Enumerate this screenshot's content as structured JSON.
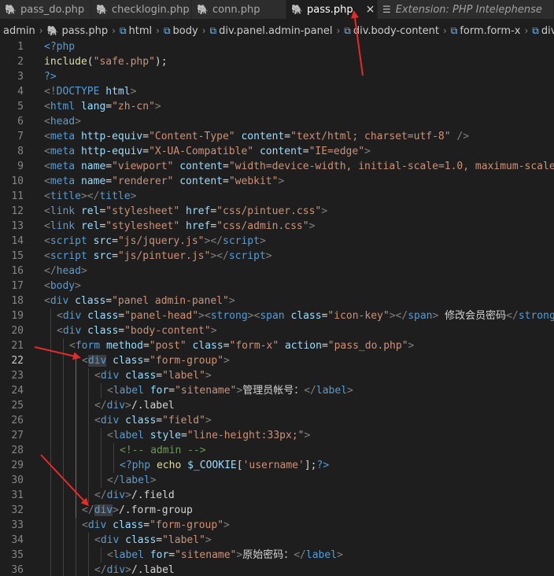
{
  "tabs": [
    {
      "label": "pass_do.php",
      "icon": "php-icon",
      "active": false
    },
    {
      "label": "checklogin.php",
      "icon": "php-icon",
      "active": false
    },
    {
      "label": "conn.php",
      "icon": "php-icon",
      "active": false
    },
    {
      "label": "pass.php",
      "icon": "php-icon",
      "active": true,
      "close": "×"
    },
    {
      "label": "Extension: PHP Intelephense",
      "icon": "extension-icon",
      "active": false
    }
  ],
  "breadcrumb": [
    "admin",
    "pass.php",
    "html",
    "body",
    "div.panel.admin-panel",
    "div.body-content",
    "form.form-x",
    "div."
  ],
  "lines": [
    {
      "n": "1",
      "indent": 0,
      "tokens": [
        [
          "t-php",
          "<?php"
        ]
      ]
    },
    {
      "n": "2",
      "indent": 0,
      "tokens": [
        [
          "t-fn",
          "include"
        ],
        [
          "t-plain",
          "("
        ],
        [
          "t-str",
          "\"safe.php\""
        ],
        [
          "t-plain",
          ");"
        ]
      ]
    },
    {
      "n": "3",
      "indent": 0,
      "tokens": [
        [
          "t-php",
          "?>"
        ]
      ]
    },
    {
      "n": "4",
      "indent": 0,
      "tokens": [
        [
          "t-punc",
          "<!"
        ],
        [
          "t-tag",
          "DOCTYPE"
        ],
        [
          "t-attr",
          " html"
        ],
        [
          "t-punc",
          ">"
        ]
      ]
    },
    {
      "n": "5",
      "indent": 0,
      "tokens": [
        [
          "t-punc",
          "<"
        ],
        [
          "t-tag",
          "html"
        ],
        [
          "t-attr",
          " lang"
        ],
        [
          "t-plain",
          "="
        ],
        [
          "t-str",
          "\"zh-cn\""
        ],
        [
          "t-punc",
          ">"
        ]
      ]
    },
    {
      "n": "6",
      "indent": 0,
      "tokens": [
        [
          "t-punc",
          "<"
        ],
        [
          "t-tag",
          "head"
        ],
        [
          "t-punc",
          ">"
        ]
      ]
    },
    {
      "n": "7",
      "indent": 0,
      "tokens": [
        [
          "t-punc",
          "<"
        ],
        [
          "t-tag",
          "meta"
        ],
        [
          "t-attr",
          " http-equiv"
        ],
        [
          "t-plain",
          "="
        ],
        [
          "t-str",
          "\"Content-Type\""
        ],
        [
          "t-attr",
          " content"
        ],
        [
          "t-plain",
          "="
        ],
        [
          "t-str",
          "\"text/html; charset=utf-8\""
        ],
        [
          "t-punc",
          " />"
        ]
      ]
    },
    {
      "n": "8",
      "indent": 0,
      "tokens": [
        [
          "t-punc",
          "<"
        ],
        [
          "t-tag",
          "meta"
        ],
        [
          "t-attr",
          " http-equiv"
        ],
        [
          "t-plain",
          "="
        ],
        [
          "t-str",
          "\"X-UA-Compatible\""
        ],
        [
          "t-attr",
          " content"
        ],
        [
          "t-plain",
          "="
        ],
        [
          "t-str",
          "\"IE=edge\""
        ],
        [
          "t-punc",
          ">"
        ]
      ]
    },
    {
      "n": "9",
      "indent": 0,
      "tokens": [
        [
          "t-punc",
          "<"
        ],
        [
          "t-tag",
          "meta"
        ],
        [
          "t-attr",
          " name"
        ],
        [
          "t-plain",
          "="
        ],
        [
          "t-str",
          "\"viewport\""
        ],
        [
          "t-attr",
          " content"
        ],
        [
          "t-plain",
          "="
        ],
        [
          "t-str",
          "\"width=device-width, initial-scale=1.0, maximum-scale="
        ]
      ]
    },
    {
      "n": "10",
      "indent": 0,
      "tokens": [
        [
          "t-punc",
          "<"
        ],
        [
          "t-tag",
          "meta"
        ],
        [
          "t-attr",
          " name"
        ],
        [
          "t-plain",
          "="
        ],
        [
          "t-str",
          "\"renderer\""
        ],
        [
          "t-attr",
          " content"
        ],
        [
          "t-plain",
          "="
        ],
        [
          "t-str",
          "\"webkit\""
        ],
        [
          "t-punc",
          ">"
        ]
      ]
    },
    {
      "n": "11",
      "indent": 0,
      "tokens": [
        [
          "t-punc",
          "<"
        ],
        [
          "t-tag",
          "title"
        ],
        [
          "t-punc",
          "></"
        ],
        [
          "t-tag",
          "title"
        ],
        [
          "t-punc",
          ">"
        ]
      ]
    },
    {
      "n": "12",
      "indent": 0,
      "tokens": [
        [
          "t-punc",
          "<"
        ],
        [
          "t-tag",
          "link"
        ],
        [
          "t-attr",
          " rel"
        ],
        [
          "t-plain",
          "="
        ],
        [
          "t-str",
          "\"stylesheet\""
        ],
        [
          "t-attr",
          " href"
        ],
        [
          "t-plain",
          "="
        ],
        [
          "t-str",
          "\"css/pintuer.css\""
        ],
        [
          "t-punc",
          ">"
        ]
      ]
    },
    {
      "n": "13",
      "indent": 0,
      "tokens": [
        [
          "t-punc",
          "<"
        ],
        [
          "t-tag",
          "link"
        ],
        [
          "t-attr",
          " rel"
        ],
        [
          "t-plain",
          "="
        ],
        [
          "t-str",
          "\"stylesheet\""
        ],
        [
          "t-attr",
          " href"
        ],
        [
          "t-plain",
          "="
        ],
        [
          "t-str",
          "\"css/admin.css\""
        ],
        [
          "t-punc",
          ">"
        ]
      ]
    },
    {
      "n": "14",
      "indent": 0,
      "tokens": [
        [
          "t-punc",
          "<"
        ],
        [
          "t-tag",
          "script"
        ],
        [
          "t-attr",
          " src"
        ],
        [
          "t-plain",
          "="
        ],
        [
          "t-str",
          "\"js/jquery.js\""
        ],
        [
          "t-punc",
          "></"
        ],
        [
          "t-tag",
          "script"
        ],
        [
          "t-punc",
          ">"
        ]
      ]
    },
    {
      "n": "15",
      "indent": 0,
      "tokens": [
        [
          "t-punc",
          "<"
        ],
        [
          "t-tag",
          "script"
        ],
        [
          "t-attr",
          " src"
        ],
        [
          "t-plain",
          "="
        ],
        [
          "t-str",
          "\"js/pintuer.js\""
        ],
        [
          "t-punc",
          "></"
        ],
        [
          "t-tag",
          "script"
        ],
        [
          "t-punc",
          ">"
        ]
      ]
    },
    {
      "n": "16",
      "indent": 0,
      "tokens": [
        [
          "t-punc",
          "</"
        ],
        [
          "t-tag",
          "head"
        ],
        [
          "t-punc",
          ">"
        ]
      ]
    },
    {
      "n": "17",
      "indent": 0,
      "tokens": [
        [
          "t-punc",
          "<"
        ],
        [
          "t-tag",
          "body"
        ],
        [
          "t-punc",
          ">"
        ]
      ]
    },
    {
      "n": "18",
      "indent": 0,
      "tokens": [
        [
          "t-punc",
          "<"
        ],
        [
          "t-tag",
          "div"
        ],
        [
          "t-attr",
          " class"
        ],
        [
          "t-plain",
          "="
        ],
        [
          "t-str",
          "\"panel admin-panel\""
        ],
        [
          "t-punc",
          ">"
        ]
      ]
    },
    {
      "n": "19",
      "indent": 1,
      "tokens": [
        [
          "t-punc",
          "<"
        ],
        [
          "t-tag",
          "div"
        ],
        [
          "t-attr",
          " class"
        ],
        [
          "t-plain",
          "="
        ],
        [
          "t-str",
          "\"panel-head\""
        ],
        [
          "t-punc",
          "><"
        ],
        [
          "t-tag",
          "strong"
        ],
        [
          "t-punc",
          "><"
        ],
        [
          "t-tag",
          "span"
        ],
        [
          "t-attr",
          " class"
        ],
        [
          "t-plain",
          "="
        ],
        [
          "t-str",
          "\"icon-key\""
        ],
        [
          "t-punc",
          "></"
        ],
        [
          "t-tag",
          "span"
        ],
        [
          "t-punc",
          ">"
        ],
        [
          "t-txt",
          " 修改会员密码"
        ],
        [
          "t-punc",
          "</"
        ],
        [
          "t-tag",
          "strong"
        ]
      ]
    },
    {
      "n": "20",
      "indent": 1,
      "tokens": [
        [
          "t-punc",
          "<"
        ],
        [
          "t-tag",
          "div"
        ],
        [
          "t-attr",
          " class"
        ],
        [
          "t-plain",
          "="
        ],
        [
          "t-str",
          "\"body-content\""
        ],
        [
          "t-punc",
          ">"
        ]
      ]
    },
    {
      "n": "21",
      "indent": 2,
      "tokens": [
        [
          "t-punc",
          "<"
        ],
        [
          "t-tag",
          "form"
        ],
        [
          "t-attr",
          " method"
        ],
        [
          "t-plain",
          "="
        ],
        [
          "t-str",
          "\"post\""
        ],
        [
          "t-attr",
          " class"
        ],
        [
          "t-plain",
          "="
        ],
        [
          "t-str",
          "\"form-x\""
        ],
        [
          "t-attr",
          " action"
        ],
        [
          "t-plain",
          "="
        ],
        [
          "t-str",
          "\"pass_do.php\""
        ],
        [
          "t-punc",
          ">"
        ]
      ]
    },
    {
      "n": "22",
      "indent": 3,
      "current": true,
      "tokens": [
        [
          "t-punc",
          "<"
        ],
        [
          "t-tag hl",
          "div"
        ],
        [
          "t-attr",
          " class"
        ],
        [
          "t-plain",
          "="
        ],
        [
          "t-str",
          "\"form-group\""
        ],
        [
          "t-punc",
          ">"
        ]
      ]
    },
    {
      "n": "23",
      "indent": 4,
      "tokens": [
        [
          "t-punc",
          "<"
        ],
        [
          "t-tag",
          "div"
        ],
        [
          "t-attr",
          " class"
        ],
        [
          "t-plain",
          "="
        ],
        [
          "t-str",
          "\"label\""
        ],
        [
          "t-punc",
          ">"
        ]
      ]
    },
    {
      "n": "24",
      "indent": 5,
      "tokens": [
        [
          "t-punc",
          "<"
        ],
        [
          "t-tag",
          "label"
        ],
        [
          "t-attr",
          " for"
        ],
        [
          "t-plain",
          "="
        ],
        [
          "t-str",
          "\"sitename\""
        ],
        [
          "t-punc",
          ">"
        ],
        [
          "t-txt",
          "管理员帐号："
        ],
        [
          "t-punc",
          "</"
        ],
        [
          "t-tag",
          "label"
        ],
        [
          "t-punc",
          ">"
        ]
      ]
    },
    {
      "n": "25",
      "indent": 4,
      "tokens": [
        [
          "t-punc",
          "</"
        ],
        [
          "t-tag",
          "div"
        ],
        [
          "t-punc",
          ">"
        ],
        [
          "t-txt",
          "/.label"
        ]
      ]
    },
    {
      "n": "26",
      "indent": 4,
      "tokens": [
        [
          "t-punc",
          "<"
        ],
        [
          "t-tag",
          "div"
        ],
        [
          "t-attr",
          " class"
        ],
        [
          "t-plain",
          "="
        ],
        [
          "t-str",
          "\"field\""
        ],
        [
          "t-punc",
          ">"
        ]
      ]
    },
    {
      "n": "27",
      "indent": 5,
      "tokens": [
        [
          "t-punc",
          "<"
        ],
        [
          "t-tag",
          "label"
        ],
        [
          "t-attr",
          " style"
        ],
        [
          "t-plain",
          "="
        ],
        [
          "t-str",
          "\"line-height:33px;\""
        ],
        [
          "t-punc",
          ">"
        ]
      ]
    },
    {
      "n": "28",
      "indent": 6,
      "tokens": [
        [
          "t-cmt",
          "<!-- admin -->"
        ]
      ]
    },
    {
      "n": "29",
      "indent": 6,
      "tokens": [
        [
          "t-php",
          "<?php"
        ],
        [
          "t-fn",
          " echo"
        ],
        [
          "t-var",
          " $_COOKIE"
        ],
        [
          "t-plain",
          "["
        ],
        [
          "t-str",
          "'username'"
        ],
        [
          "t-plain",
          "];"
        ],
        [
          "t-php",
          "?>"
        ]
      ]
    },
    {
      "n": "30",
      "indent": 5,
      "tokens": [
        [
          "t-punc",
          "</"
        ],
        [
          "t-tag",
          "label"
        ],
        [
          "t-punc",
          ">"
        ]
      ]
    },
    {
      "n": "31",
      "indent": 4,
      "tokens": [
        [
          "t-punc",
          "</"
        ],
        [
          "t-tag",
          "div"
        ],
        [
          "t-punc",
          ">"
        ],
        [
          "t-txt",
          "/.field"
        ]
      ]
    },
    {
      "n": "32",
      "indent": 3,
      "tokens": [
        [
          "t-punc",
          "</"
        ],
        [
          "t-tag hl",
          "div"
        ],
        [
          "t-punc",
          ">"
        ],
        [
          "t-txt",
          "/.form-group"
        ]
      ]
    },
    {
      "n": "33",
      "indent": 3,
      "tokens": [
        [
          "t-punc",
          "<"
        ],
        [
          "t-tag",
          "div"
        ],
        [
          "t-attr",
          " class"
        ],
        [
          "t-plain",
          "="
        ],
        [
          "t-str",
          "\"form-group\""
        ],
        [
          "t-punc",
          ">"
        ]
      ]
    },
    {
      "n": "34",
      "indent": 4,
      "tokens": [
        [
          "t-punc",
          "<"
        ],
        [
          "t-tag",
          "div"
        ],
        [
          "t-attr",
          " class"
        ],
        [
          "t-plain",
          "="
        ],
        [
          "t-str",
          "\"label\""
        ],
        [
          "t-punc",
          ">"
        ]
      ]
    },
    {
      "n": "35",
      "indent": 5,
      "tokens": [
        [
          "t-punc",
          "<"
        ],
        [
          "t-tag",
          "label"
        ],
        [
          "t-attr",
          " for"
        ],
        [
          "t-plain",
          "="
        ],
        [
          "t-str",
          "\"sitename\""
        ],
        [
          "t-punc",
          ">"
        ],
        [
          "t-txt",
          "原始密码："
        ],
        [
          "t-punc",
          "</"
        ],
        [
          "t-tag",
          "label"
        ],
        [
          "t-punc",
          ">"
        ]
      ]
    },
    {
      "n": "36",
      "indent": 4,
      "tokens": [
        [
          "t-punc",
          "</"
        ],
        [
          "t-tag",
          "div"
        ],
        [
          "t-punc",
          ">"
        ],
        [
          "t-txt",
          "/.label"
        ]
      ]
    }
  ],
  "colors": {
    "background": "#1e1e1e",
    "tab_bar": "#252526",
    "annotation_arrow": "#e52a2a"
  }
}
